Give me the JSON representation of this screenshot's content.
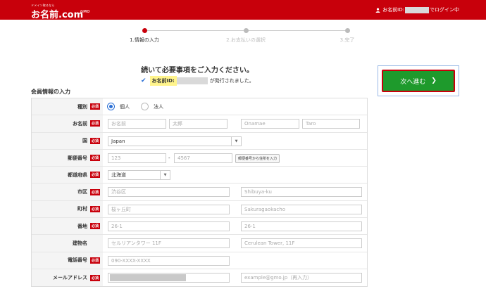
{
  "header": {
    "logo_tag": "ドメイン取るなら",
    "logo_main": "お名前.com",
    "logo_sub": "GMO",
    "login_prefix": "お名前ID:",
    "login_suffix": "でログイン中",
    "user_icon": "user-icon"
  },
  "steps": [
    {
      "label": "1.情報の入力",
      "active": true
    },
    {
      "label": "2.お支払いの選択",
      "active": false
    },
    {
      "label": "3.完了",
      "active": false
    }
  ],
  "headline": "続いて必要事項をご入力ください。",
  "notice": {
    "label": "お名前ID:",
    "after": "が発行されました。"
  },
  "next_button": "次へ進む",
  "section_title": "会員情報の入力",
  "required_badge": "必須",
  "form": {
    "type": {
      "label": "種別",
      "options": [
        "個人",
        "法人"
      ],
      "selected": "個人"
    },
    "name": {
      "label": "お名前",
      "ph": [
        "お名前",
        "太郎",
        "Onamae",
        "Taro"
      ]
    },
    "country": {
      "label": "国",
      "value": "Japan"
    },
    "zip": {
      "label": "郵便番号",
      "ph": [
        "123",
        "4567"
      ],
      "button": "郵便番号から住所を入力"
    },
    "prefecture": {
      "label": "都道府県",
      "value": "北海道"
    },
    "city": {
      "label": "市区",
      "ph": [
        "渋谷区",
        "Shibuya-ku"
      ]
    },
    "town": {
      "label": "町村",
      "ph": [
        "桜ヶ丘町",
        "Sakuragaokacho"
      ]
    },
    "block": {
      "label": "番地",
      "ph": [
        "26-1",
        "26-1"
      ]
    },
    "building": {
      "label": "建物名",
      "ph": [
        "セルリアンタワー 11F",
        "Cerulean Tower, 11F"
      ]
    },
    "phone": {
      "label": "電話番号",
      "ph": [
        "090-XXXX-XXXX"
      ]
    },
    "email": {
      "label": "メールアドレス",
      "ph": [
        "example@gmo.jp（再入力）"
      ]
    }
  },
  "colors": {
    "brand": "#c8000b",
    "accent_green": "#1e9a2c",
    "radio_blue": "#2a6fd6"
  }
}
